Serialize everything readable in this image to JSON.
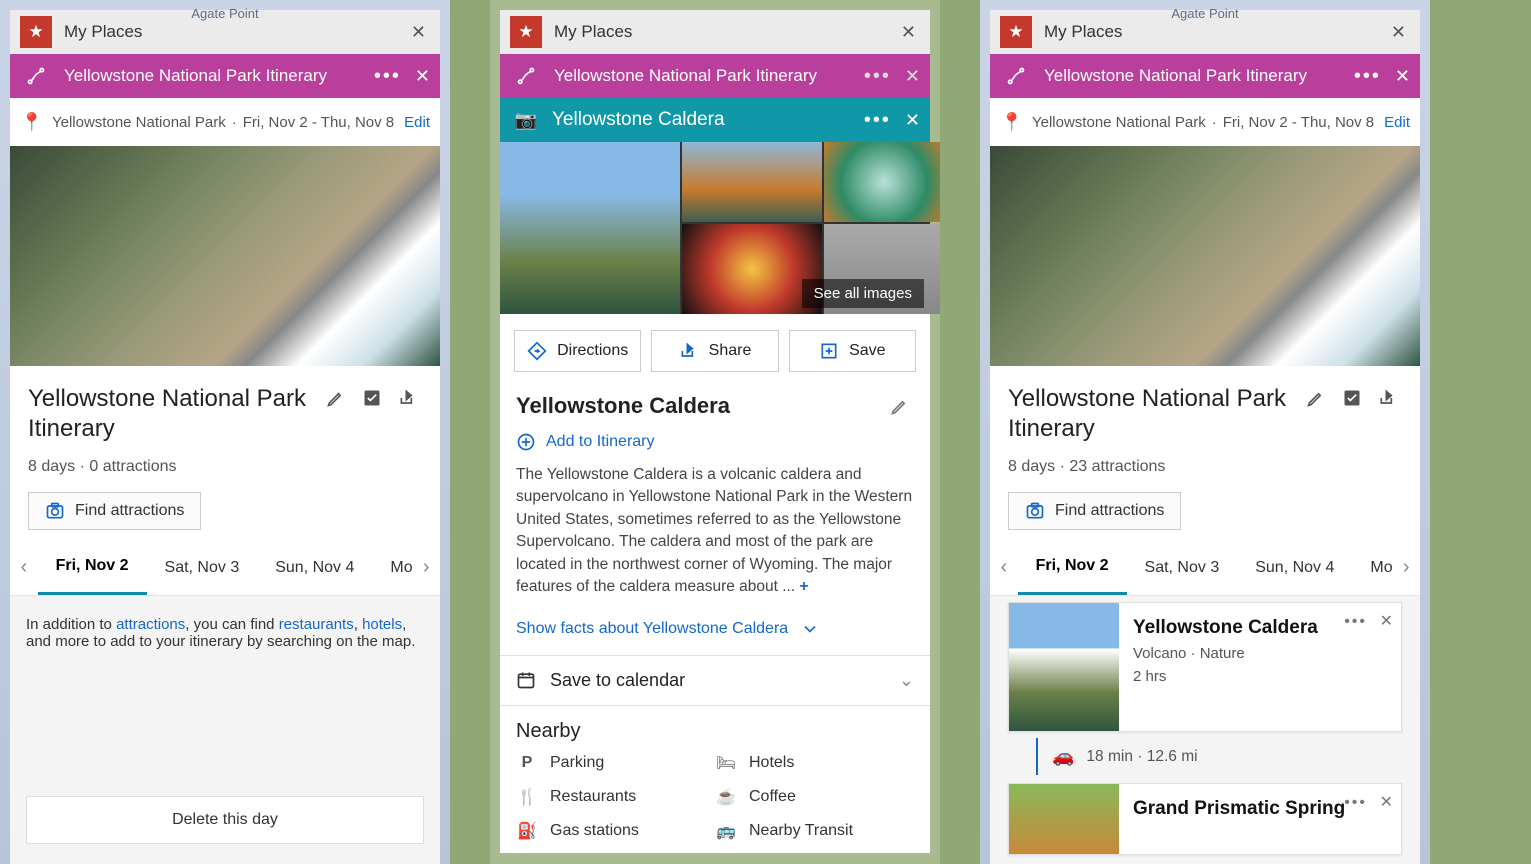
{
  "map_label": "Agate Point",
  "myplaces": {
    "label": "My Places"
  },
  "itinerary": {
    "title": "Yellowstone National Park Itinerary",
    "place": "Yellowstone National Park",
    "daterange": "Fri, Nov 2 - Thu, Nov 8",
    "edit": "Edit",
    "main_title": "Yellowstone National Park Itinerary",
    "sub_left": "8 days · 0 attractions",
    "sub_right": "8 days · 23 attractions",
    "find": "Find attractions",
    "tabs": [
      "Fri, Nov 2",
      "Sat, Nov 3",
      "Sun, Nov 4",
      "Mon"
    ],
    "hint_pre": "In addition to ",
    "hint_attractions": "attractions",
    "hint_mid": ", you can find ",
    "hint_restaurants": "restaurants",
    "hint_sep": ", ",
    "hint_hotels": "hotels",
    "hint_post": ", and more to add to your itinerary by searching on the map.",
    "delete": "Delete this day"
  },
  "caldera": {
    "bar_title": "Yellowstone Caldera",
    "see_all": "See all images",
    "actions": {
      "directions": "Directions",
      "share": "Share",
      "save": "Save"
    },
    "title": "Yellowstone Caldera",
    "add_itin": "Add to Itinerary",
    "desc": "The Yellowstone Caldera is a volcanic caldera and supervolcano in Yellowstone National Park in the Western United States, sometimes referred to as the Yellowstone Supervolcano. The caldera and most of the park are located in the northwest corner of Wyoming. The major features of the caldera measure about ... ",
    "more": "+",
    "facts": "Show facts about Yellowstone Caldera",
    "save_calendar": "Save to calendar",
    "nearby_title": "Nearby",
    "nearby": {
      "parking": "Parking",
      "hotels": "Hotels",
      "restaurants": "Restaurants",
      "coffee": "Coffee",
      "gas": "Gas stations",
      "transit": "Nearby Transit"
    }
  },
  "cards": {
    "c1": {
      "title": "Yellowstone Caldera",
      "sub": "Volcano · Nature",
      "dur": "2 hrs"
    },
    "travel": "18 min · 12.6 mi",
    "c2": {
      "title": "Grand Prismatic Spring"
    }
  }
}
